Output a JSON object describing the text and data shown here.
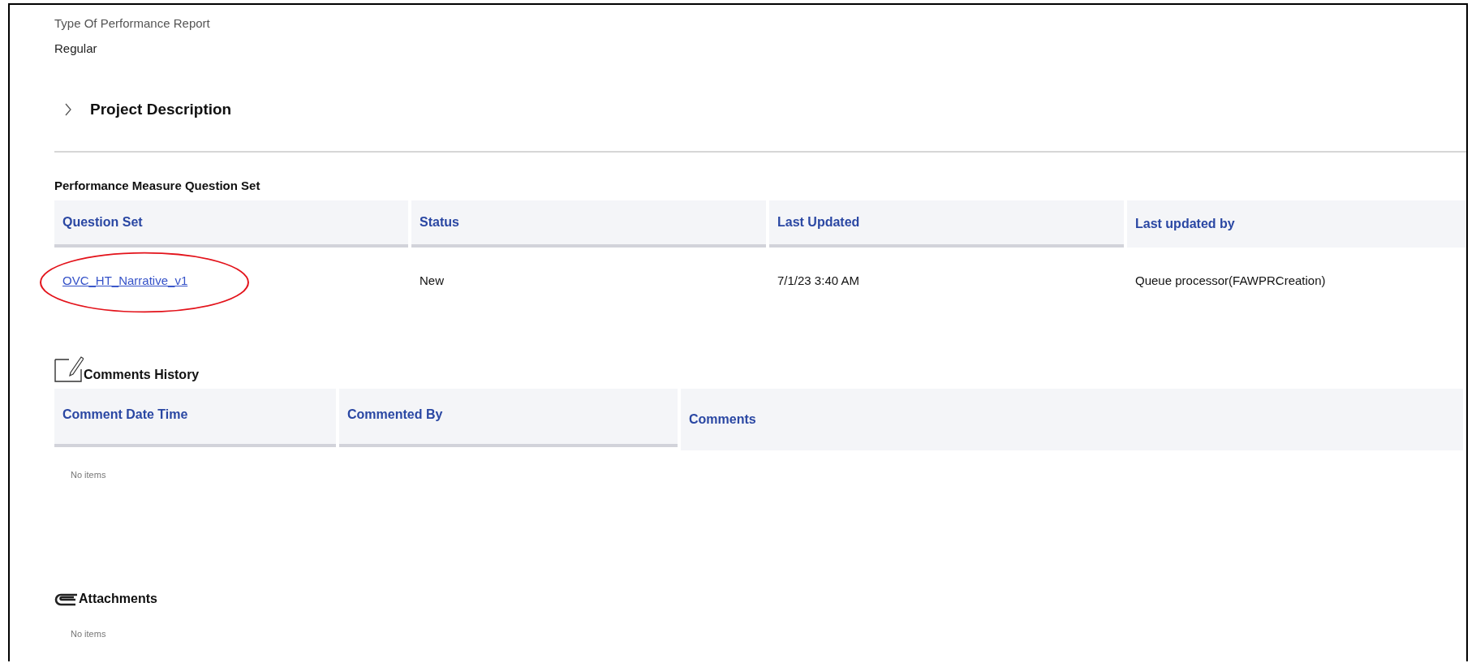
{
  "field": {
    "label": "Type Of Performance Report",
    "value": "Regular"
  },
  "project_section": {
    "title": "Project Description",
    "expanded": false
  },
  "question_set": {
    "title": "Performance Measure Question Set",
    "columns": [
      {
        "label": "Question Set",
        "sorted": true
      },
      {
        "label": "Status",
        "sorted": true
      },
      {
        "label": "Last Updated",
        "sorted": true
      },
      {
        "label": "Last updated by",
        "sorted": false
      }
    ],
    "rows": [
      {
        "question_set": "OVC_HT_Narrative_v1",
        "status": "New",
        "last_updated": "7/1/23 3:40 AM",
        "last_updated_by": "Queue processor(FAWPRCreation)",
        "circled": true
      }
    ]
  },
  "comments_history": {
    "title": "Comments History",
    "columns": [
      {
        "label": "Comment Date Time",
        "sorted": true
      },
      {
        "label": "Commented By",
        "sorted": true
      },
      {
        "label": "Comments",
        "sorted": false
      }
    ],
    "empty_text": "No items"
  },
  "attachments": {
    "title": "Attachments",
    "empty_text": "No items"
  }
}
